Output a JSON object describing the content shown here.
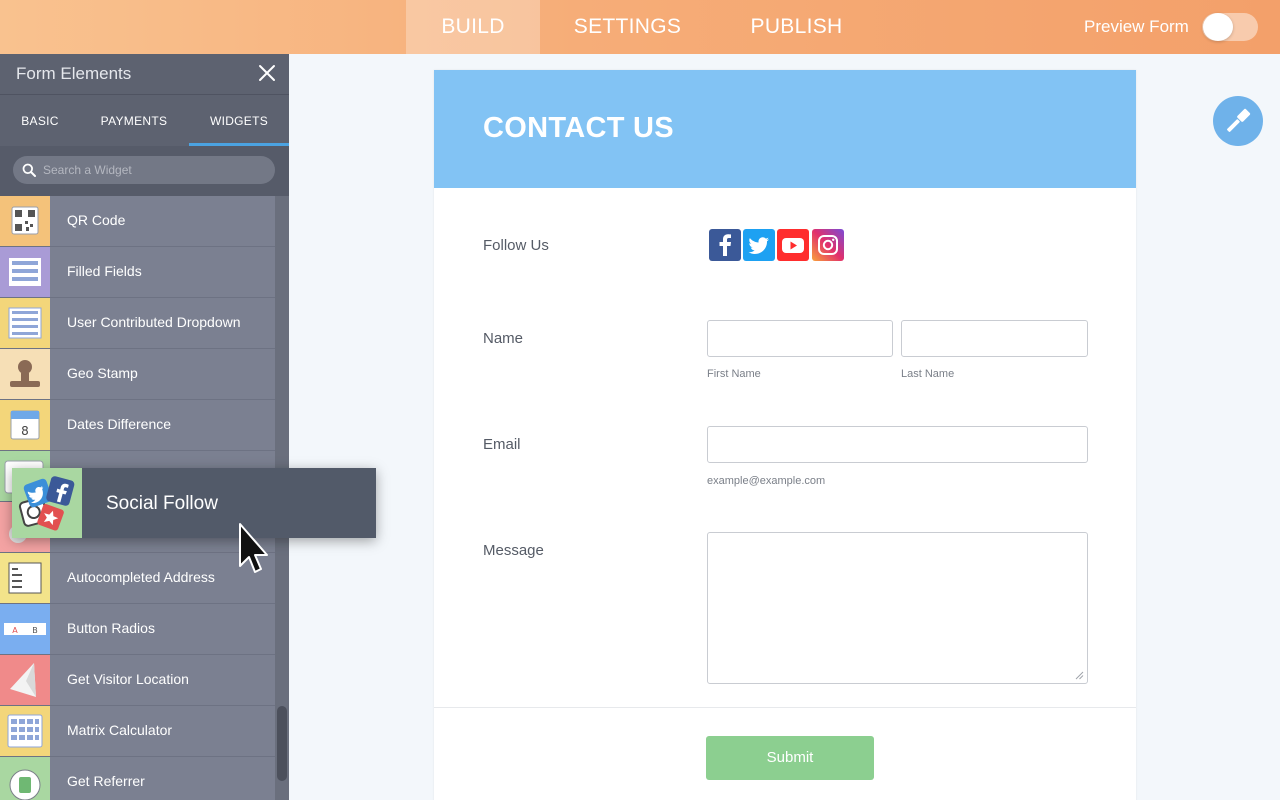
{
  "topbar": {
    "tabs": [
      {
        "label": "BUILD",
        "active": true
      },
      {
        "label": "SETTINGS",
        "active": false
      },
      {
        "label": "PUBLISH",
        "active": false
      }
    ],
    "preview_label": "Preview Form",
    "preview_enabled": false
  },
  "sidebar": {
    "title": "Form Elements",
    "close_icon": "close-icon",
    "tabs": [
      {
        "label": "BASIC",
        "active": false
      },
      {
        "label": "PAYMENTS",
        "active": false
      },
      {
        "label": "WIDGETS",
        "active": true
      }
    ],
    "search": {
      "placeholder": "Search a Widget",
      "value": ""
    },
    "items": [
      {
        "label": "QR Code",
        "icon": "qr-code-icon",
        "color": "#f4c27a"
      },
      {
        "label": "Filled Fields",
        "icon": "filled-fields-icon",
        "color": "#a99bd6"
      },
      {
        "label": "User Contributed Dropdown",
        "icon": "dropdown-list-icon",
        "color": "#f3d67a"
      },
      {
        "label": "Geo Stamp",
        "icon": "geo-stamp-icon",
        "color": "#f6dfb6"
      },
      {
        "label": "Dates Difference",
        "icon": "calendar-icon",
        "color": "#f3d67a"
      },
      {
        "label": "",
        "icon": "calendar-icon",
        "color": "#a9d7a1"
      },
      {
        "label": "",
        "icon": "social-icon",
        "color": "#f4a3a3"
      },
      {
        "label": "Autocompleted Address",
        "icon": "address-list-icon",
        "color": "#f3e38a"
      },
      {
        "label": "Button Radios",
        "icon": "button-radios-icon",
        "color": "#7aaef0"
      },
      {
        "label": "Get Visitor Location",
        "icon": "location-arrow-icon",
        "color": "#f08a8a"
      },
      {
        "label": "Matrix Calculator",
        "icon": "calculator-grid-icon",
        "color": "#f3d67a"
      },
      {
        "label": "Get Referrer",
        "icon": "referrer-icon",
        "color": "#a9d7a1"
      }
    ]
  },
  "drag": {
    "label": "Social Follow",
    "icon": "social-follow-icon"
  },
  "form": {
    "title": "CONTACT US",
    "follow_label": "Follow Us",
    "social_icons": [
      {
        "name": "facebook-icon",
        "color": "#3b5998",
        "glyph": "f"
      },
      {
        "name": "twitter-icon",
        "color": "#1da1f2",
        "glyph": ""
      },
      {
        "name": "youtube-icon",
        "color": "#ff2d2d",
        "glyph": ""
      },
      {
        "name": "instagram-icon",
        "color": "#c13584",
        "glyph": ""
      }
    ],
    "name_label": "Name",
    "first_name_sublabel": "First Name",
    "last_name_sublabel": "Last Name",
    "email_label": "Email",
    "email_sublabel": "example@example.com",
    "message_label": "Message",
    "submit_label": "Submit",
    "submit_color": "#8ccf90",
    "header_color": "#82c3f4"
  },
  "magic_button": {
    "icon": "wand-icon"
  }
}
